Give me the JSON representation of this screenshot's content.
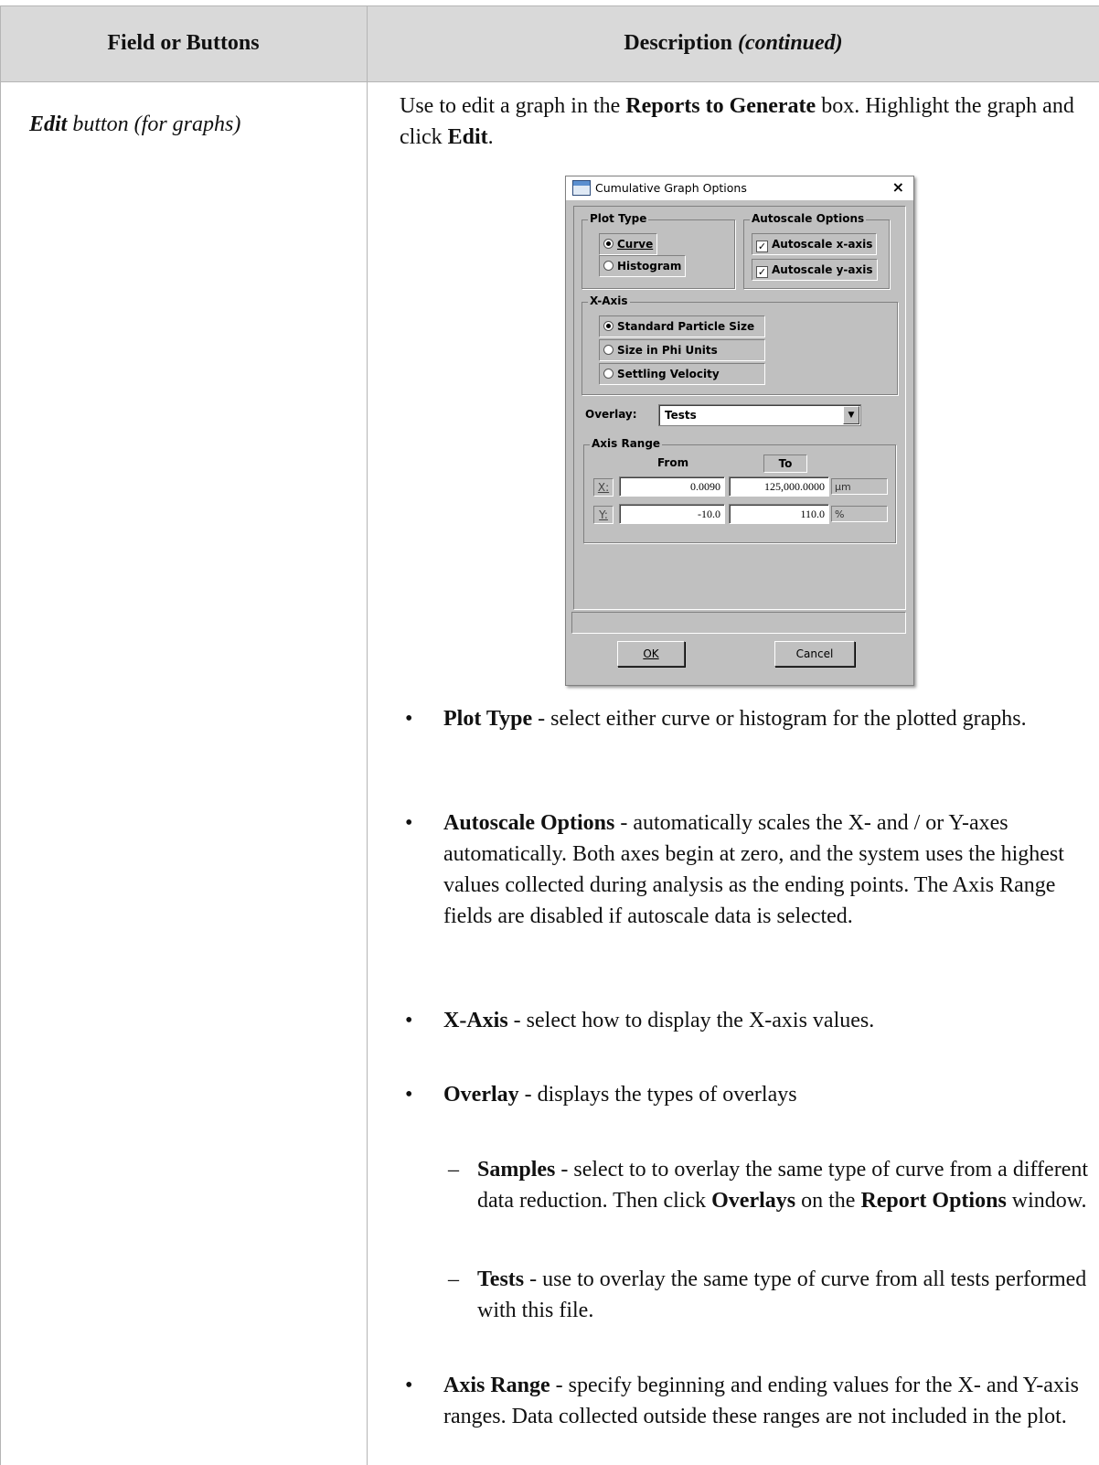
{
  "table": {
    "header": {
      "col1": "Field or Buttons",
      "col2_main": "Description",
      "col2_suffix": "(continued)"
    },
    "row": {
      "field_bold": "Edit",
      "field_rest": " button (for graphs)",
      "intro_1": "Use to edit a graph in the ",
      "intro_bold_1": "Reports to Generate",
      "intro_2": " box. Highlight the graph and click ",
      "intro_bold_2": "Edit",
      "intro_3": "."
    }
  },
  "dialog": {
    "title": "Cumulative Graph Options",
    "close_glyph": "×",
    "plot_type": {
      "label": "Plot Type",
      "curve": "Curve",
      "histogram": "Histogram",
      "selected": "Curve"
    },
    "autoscale": {
      "label": "Autoscale Options",
      "x_axis": "Autoscale x-axis",
      "y_axis": "Autoscale y-axis",
      "x_checked": true,
      "y_checked": true
    },
    "x_axis": {
      "label": "X-Axis",
      "standard": "Standard Particle Size",
      "phi": "Size in Phi Units",
      "settling": "Settling Velocity",
      "selected": "Standard Particle Size"
    },
    "overlay": {
      "label": "Overlay:",
      "value": "Tests"
    },
    "axis_range": {
      "label": "Axis Range",
      "from": "From",
      "to": "To",
      "x_label": "X:",
      "y_label": "Y:",
      "x_from": "0.0090",
      "x_to": "125,000.0000",
      "x_unit": "µm",
      "y_from": "-10.0",
      "y_to": "110.0",
      "y_unit": "%"
    },
    "ok_label": "OK",
    "cancel_label": "Cancel"
  },
  "bullets": {
    "plot_type": {
      "term": "Plot Type",
      "text": " - select either curve or histogram for the plotted graphs."
    },
    "autoscale": {
      "term": "Autoscale Options",
      "text": " - automatically scales the X- and / or Y-axes automatically. Both axes begin at zero, and the system uses the highest values collected during analysis as the ending points. The Axis Range fields are disabled if autoscale data is selected."
    },
    "x_axis": {
      "term": "X-Axis",
      "text": " - select how to display the X-axis values."
    },
    "overlay": {
      "term": "Overlay",
      "text": " - displays the types of overlays"
    },
    "samples": {
      "term": "Samples",
      "text_1": " - select to to overlay the same type of curve from a different data reduction. Then click ",
      "bold_1": "Overlays",
      "text_2": " on the ",
      "bold_2": "Report Options",
      "text_3": " window."
    },
    "tests": {
      "term": "Tests",
      "text": " - use to overlay the same type of curve from all tests performed with this file."
    },
    "axis_range": {
      "term": "Axis Range",
      "text": " - specify beginning and ending values for the X- and Y-axis ranges. Data collected outside these ranges are not included in the plot."
    },
    "bullet_glyph": "•",
    "dash_glyph": "–"
  }
}
